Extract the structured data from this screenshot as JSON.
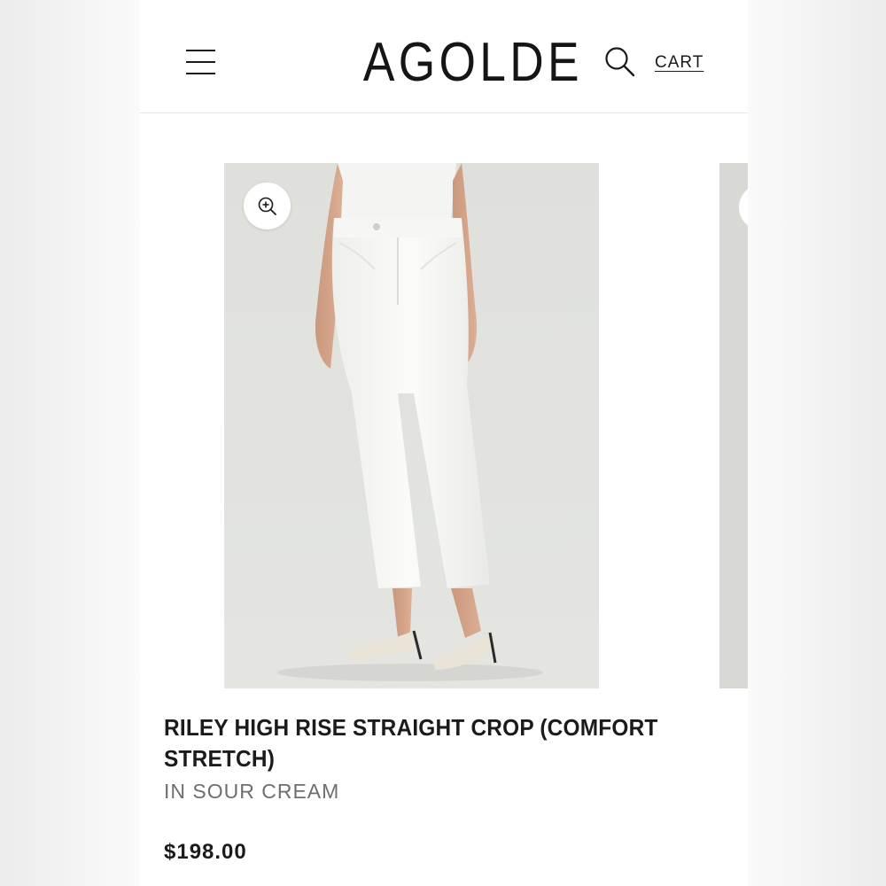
{
  "header": {
    "logo": "AGOLDE",
    "cart_label": "CART",
    "menu_icon": "hamburger-menu-icon",
    "search_icon": "search-icon"
  },
  "gallery": {
    "zoom_icon": "zoom-in-icon",
    "image_description": "model-wearing-white-jeans"
  },
  "product": {
    "title": "RILEY HIGH RISE STRAIGHT CROP (COMFORT STRETCH)",
    "color": "IN SOUR CREAM",
    "price": "$198.00"
  },
  "colors": {
    "text": "#1b1b1b",
    "muted": "#6e6e6e",
    "image_bg": "#e0e1dc"
  }
}
